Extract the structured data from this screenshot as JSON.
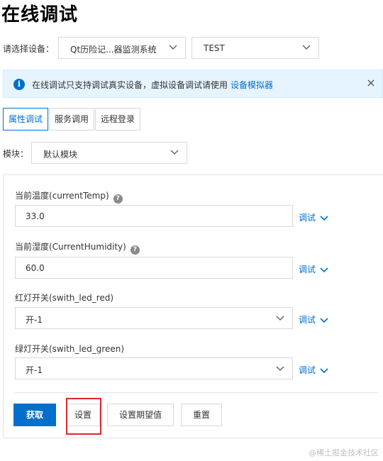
{
  "page": {
    "title": "在线调试"
  },
  "device_select": {
    "label": "请选择设备：",
    "product_value": "Qt历险记...器监测系统",
    "device_value": "TEST"
  },
  "notice": {
    "text": "在线调试只支持调试真实设备，虚拟设备调试请使用",
    "link_text": "设备模拟器"
  },
  "tabs": [
    {
      "label": "属性调试",
      "active": true
    },
    {
      "label": "服务调用",
      "active": false
    },
    {
      "label": "远程登录",
      "active": false
    }
  ],
  "module": {
    "label": "模块：",
    "value": "默认模块"
  },
  "fields": [
    {
      "label": "当前温度(currentTemp)",
      "value": "33.0",
      "has_help": true,
      "type": "input"
    },
    {
      "label": "当前湿度(CurrentHumidity)",
      "value": "60.0",
      "has_help": true,
      "type": "input"
    },
    {
      "label": "红灯开关(swith_led_red)",
      "value": "开-1",
      "has_help": false,
      "type": "select"
    },
    {
      "label": "绿灯开关(swith_led_green)",
      "value": "开-1",
      "has_help": false,
      "type": "select"
    }
  ],
  "debug_link_label": "调试",
  "buttons": {
    "get": "获取",
    "set": "设置",
    "set_expect": "设置期望值",
    "reset": "重置"
  },
  "watermark": "@稀土掘金技术社区",
  "colors": {
    "accent": "#0070cc",
    "notice_bg": "#e6f4ff",
    "highlight": "#e0262d"
  }
}
